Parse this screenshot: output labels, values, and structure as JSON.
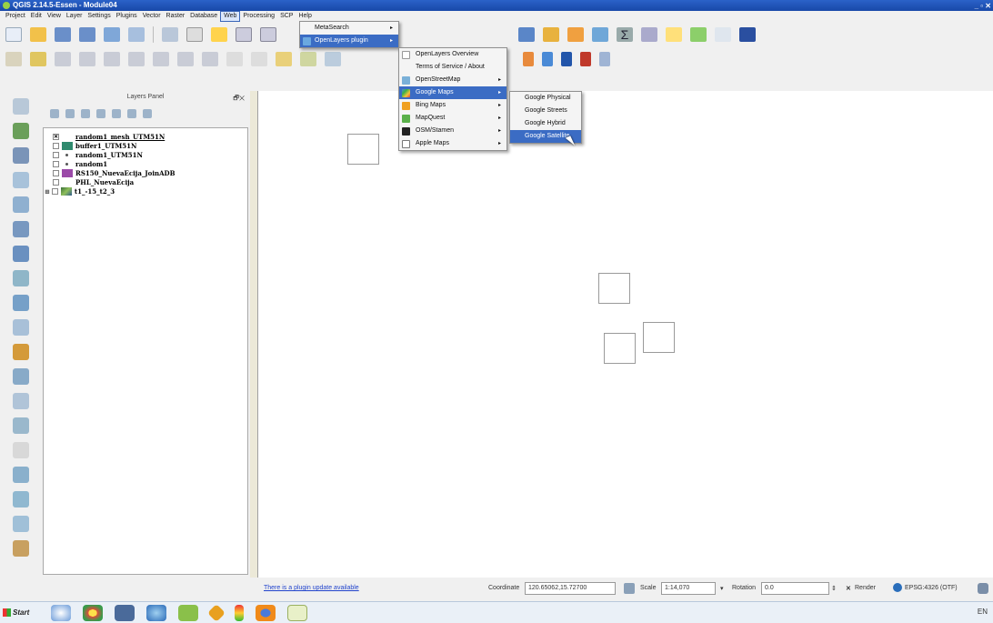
{
  "window": {
    "title": "QGIS 2.14.5-Essen - Module04",
    "controls": "_ ▫ ✕"
  },
  "menubar": {
    "items": [
      {
        "label": "Project"
      },
      {
        "label": "Edit"
      },
      {
        "label": "View"
      },
      {
        "label": "Layer"
      },
      {
        "label": "Settings"
      },
      {
        "label": "Plugins"
      },
      {
        "label": "Vector"
      },
      {
        "label": "Raster"
      },
      {
        "label": "Database"
      },
      {
        "label": "Web"
      },
      {
        "label": "Processing"
      },
      {
        "label": "SCP"
      },
      {
        "label": "Help"
      }
    ],
    "active": "Web"
  },
  "web_menu": {
    "items": [
      {
        "label": "MetaSearch"
      },
      {
        "label": "OpenLayers plugin"
      }
    ]
  },
  "openlayers_menu": {
    "items": [
      {
        "label": "OpenLayers Overview"
      },
      {
        "label": "Terms of Service / About"
      },
      {
        "label": "OpenStreetMap"
      },
      {
        "label": "Google Maps"
      },
      {
        "label": "Bing Maps"
      },
      {
        "label": "MapQuest"
      },
      {
        "label": "OSM/Stamen"
      },
      {
        "label": "Apple Maps"
      }
    ]
  },
  "google_menu": {
    "items": [
      {
        "label": "Google Physical"
      },
      {
        "label": "Google Streets"
      },
      {
        "label": "Google Hybrid"
      },
      {
        "label": "Google Satellite"
      }
    ],
    "highlighted": "Google Satellite"
  },
  "layers_panel": {
    "title": "Layers Panel",
    "buttons": "🗗✕",
    "layers": [
      {
        "name": "random1_mesh_UTM51N",
        "checked": "✕",
        "symbol": "none"
      },
      {
        "name": "buffer1_UTM51N",
        "symbol": "fill",
        "color": "#2f8a6e"
      },
      {
        "name": "random1_UTM51N",
        "symbol": "point"
      },
      {
        "name": "random1",
        "symbol": "point"
      },
      {
        "name": "RS150_NuevaEcija_JoinADB",
        "symbol": "fill",
        "color": "#9b4aa8"
      },
      {
        "name": "PHL_NuevaEcija",
        "symbol": "none"
      },
      {
        "name": "t1_-15_t2_3",
        "symbol": "raster",
        "expander": "⊞"
      }
    ]
  },
  "statusbar": {
    "update_link": "There is a plugin update available",
    "coordinate_label": "Coordinate",
    "coordinate_value": "120.65062,15.72700",
    "scale_label": "Scale",
    "scale_value": "1:14,070",
    "rotation_label": "Rotation",
    "rotation_value": "0.0",
    "render_label": "Render",
    "crs": "EPSG:4326 (OTF)"
  },
  "taskbar": {
    "start_label": "Start",
    "tray": "EN"
  },
  "colors": {
    "accent": "#3b6cc4",
    "titlebar": "#1848a8"
  }
}
